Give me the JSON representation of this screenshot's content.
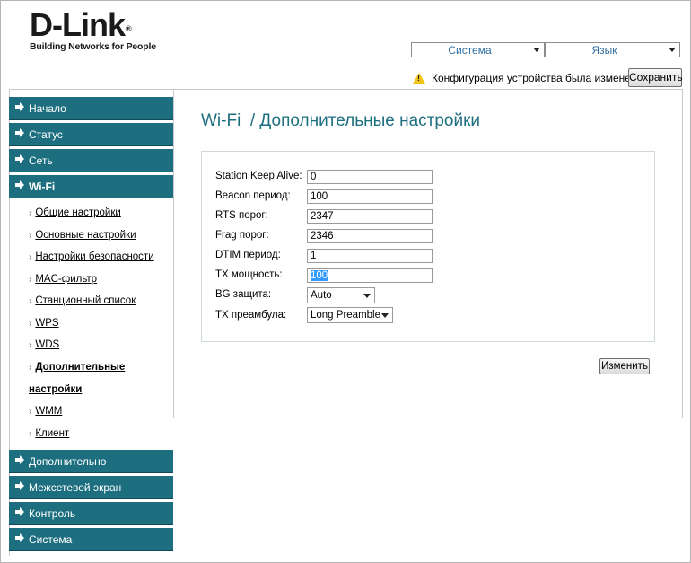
{
  "header": {
    "logo_text": "D-Link",
    "logo_mark": "®",
    "logo_tagline": "Building Networks for People",
    "system_menu": "Система",
    "language_menu": "Язык",
    "notice": "Конфигурация устройства была изменена",
    "save_label": "Сохранить",
    "notice_icon": "warning-icon"
  },
  "sidebar": {
    "items": [
      {
        "label": "Начало"
      },
      {
        "label": "Статус"
      },
      {
        "label": "Сеть"
      },
      {
        "label": "Wi-Fi"
      },
      {
        "label": "Дополнительно"
      },
      {
        "label": "Межсетевой экран"
      },
      {
        "label": "Контроль"
      },
      {
        "label": "Система"
      }
    ],
    "active": "Wi-Fi",
    "sub_items": [
      {
        "label": "Общие настройки"
      },
      {
        "label": "Основные настройки"
      },
      {
        "label": "Настройки безопасности"
      },
      {
        "label": "MAC-фильтр"
      },
      {
        "label": "Станционный список"
      },
      {
        "label": "WPS"
      },
      {
        "label": "WDS"
      },
      {
        "label_line1": "Дополнительные",
        "label_line2": "настройки"
      },
      {
        "label": "WMM"
      },
      {
        "label": "Клиент"
      }
    ],
    "bullet": "›"
  },
  "main": {
    "title": "Wi-Fi  / Дополнительные настройки",
    "fields": [
      {
        "label": "Station Keep Alive:",
        "value": "0"
      },
      {
        "label": "Beacon период:",
        "value": "100"
      },
      {
        "label": "RTS порог:",
        "value": "2347"
      },
      {
        "label": "Frag порог:",
        "value": "2346"
      },
      {
        "label": "DTIM период:",
        "value": "1"
      },
      {
        "label": "TX мощность:",
        "value": "100"
      },
      {
        "label": "BG защита:",
        "value": "Auto"
      },
      {
        "label": "TX преамбула:",
        "value": "Long Preamble"
      }
    ],
    "apply_label": "Изменить"
  },
  "colors": {
    "accent": "#1d6f7f",
    "menu_text": "#2e6ea0",
    "warning": "#f0c419",
    "selection": "#3399ff"
  }
}
